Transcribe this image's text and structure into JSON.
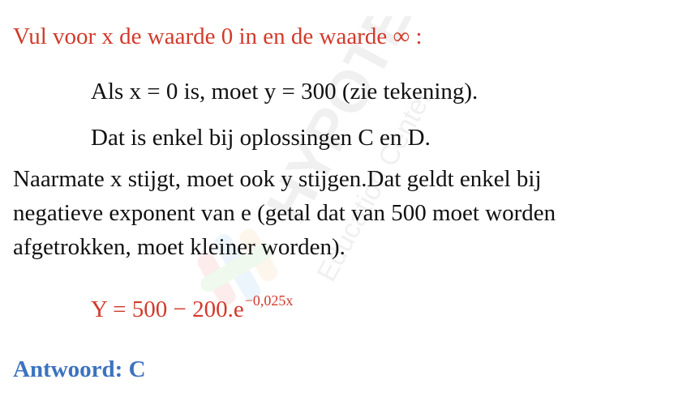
{
  "heading": "Vul voor x de waarde 0 in en de waarde ∞ :",
  "lines": [
    "Als x = 0 is, moet y = 300 (zie tekening).",
    "Dat is enkel bij oplossingen C en D."
  ],
  "paragraph": [
    "Naarmate x stijgt, moet ook y stijgen.Dat geldt enkel bij",
    "negatieve exponent van e (getal dat van 500 moet worden",
    "afgetrokken, moet kleiner worden)."
  ],
  "formula": {
    "base": "Y = 500 − 200.e",
    "exponent": "−0,025x"
  },
  "answer": "Antwoord: C",
  "watermark": {
    "brand": "HYPOTENUSE",
    "sub": "Education Center"
  },
  "colors": {
    "accent_red": "#d23a2b",
    "answer_blue": "#3b73c0"
  }
}
